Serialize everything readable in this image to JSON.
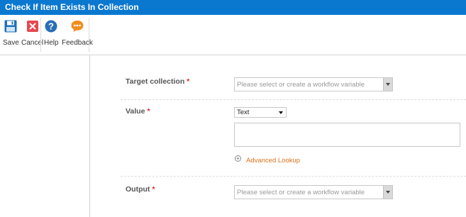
{
  "window": {
    "title": "Check If Item Exists In Collection"
  },
  "toolbar": {
    "save_label": "Save",
    "cancel_label": "Cancel",
    "help_label": "Help",
    "feedback_label": "Feedback"
  },
  "form": {
    "target_collection": {
      "label": "Target collection",
      "required_mark": "*",
      "placeholder": "Please select or create a workflow variable"
    },
    "value": {
      "label": "Value",
      "required_mark": "*",
      "type_selected": "Text",
      "text_value": "",
      "advanced_lookup_label": "Advanced Lookup"
    },
    "output": {
      "label": "Output",
      "required_mark": "*",
      "placeholder": "Please select or create a workflow variable"
    }
  },
  "colors": {
    "titlebar": "#0b78cf",
    "accent_orange": "#e07018",
    "required_red": "#d9262b"
  }
}
